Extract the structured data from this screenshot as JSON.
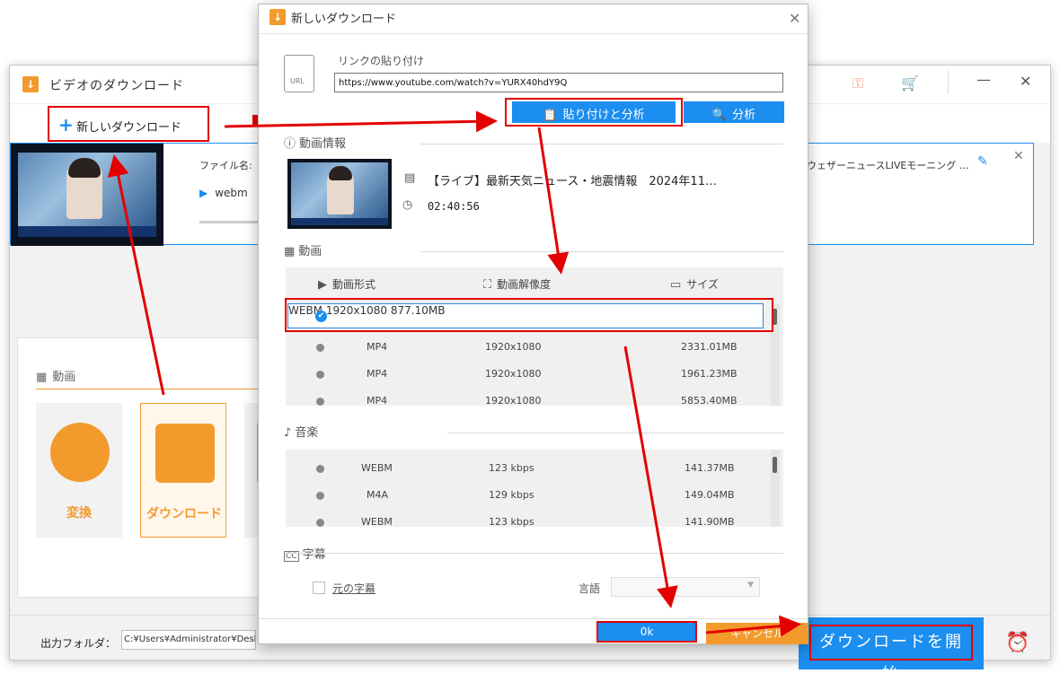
{
  "main": {
    "title": "ビデオのダウンロード",
    "new_download_label": "新しいダウンロード",
    "task": {
      "file_label": "ファイル名:【ライ",
      "format": "webm",
      "title_right": "ウェザーニュースLIVEモーニング  …"
    },
    "toolbox": {
      "section_label": "動画",
      "convert_label": "変換",
      "download_label": "ダウンロード"
    },
    "output_label": "出力フォルダ：",
    "output_path": "C:¥Users¥Administrator¥Desktop",
    "start_download_label": "ダウンロードを開始"
  },
  "dialog": {
    "title": "新しいダウンロード",
    "url_icon_text": "URL",
    "paste_link_label": "リンクの貼り付け",
    "url_value": "https://www.youtube.com/watch?v=YURX40hdY9Q",
    "paste_analyze_label": "貼り付けと分析",
    "analyze_label": "分析",
    "video_info_label": "動画情報",
    "video_title": "【ライブ】最新天気ニュース・地震情報　2024年11…",
    "duration": "02:40:56",
    "video_section_label": "動画",
    "video_columns": [
      "動画形式",
      "動画解像度",
      "サイズ"
    ],
    "video_rows": [
      {
        "format": "WEBM",
        "resolution": "1920x1080",
        "size": "877.10MB",
        "selected": true
      },
      {
        "format": "MP4",
        "resolution": "1920x1080",
        "size": "2331.01MB",
        "selected": false
      },
      {
        "format": "MP4",
        "resolution": "1920x1080",
        "size": "1961.23MB",
        "selected": false
      },
      {
        "format": "MP4",
        "resolution": "1920x1080",
        "size": "5853.40MB",
        "selected": false
      }
    ],
    "music_section_label": "音楽",
    "music_rows": [
      {
        "format": "WEBM",
        "bitrate": "123 kbps",
        "size": "141.37MB"
      },
      {
        "format": "M4A",
        "bitrate": "129 kbps",
        "size": "149.04MB"
      },
      {
        "format": "WEBM",
        "bitrate": "123 kbps",
        "size": "141.90MB"
      }
    ],
    "subtitle_section_label": "字幕",
    "original_subtitle_label": "元の字幕",
    "language_label": "言語",
    "ok_label": "0k",
    "cancel_label": "キャンセル"
  },
  "colors": {
    "accent": "#1b8ef0",
    "orange": "#f39a2c",
    "highlight": "#e30000"
  }
}
